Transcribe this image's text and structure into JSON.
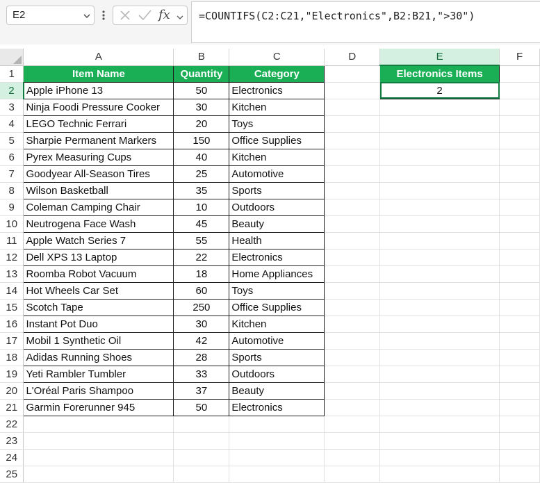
{
  "namebox": {
    "value": "E2"
  },
  "formula_bar": {
    "cancel_icon": "x-icon",
    "enter_icon": "check-icon",
    "function_icon": "fx-icon",
    "formula": "=COUNTIFS(C2:C21,\"Electronics\",B2:B21,\">30\")"
  },
  "grid": {
    "columns": [
      "A",
      "B",
      "C",
      "D",
      "E",
      "F"
    ],
    "active_column": "E",
    "active_row": "2",
    "header_fill": "#1aaf54",
    "row_numbers": [
      "1",
      "2",
      "3",
      "4",
      "5",
      "6",
      "7",
      "8",
      "9",
      "10",
      "11",
      "12",
      "13",
      "14",
      "15",
      "16",
      "17",
      "18",
      "19",
      "20",
      "21",
      "22",
      "23",
      "24",
      "25"
    ],
    "table_headers": [
      "Item Name",
      "Quantity",
      "Category"
    ],
    "rows": [
      [
        "Apple iPhone 13",
        "50",
        "Electronics"
      ],
      [
        "Ninja Foodi Pressure Cooker",
        "30",
        "Kitchen"
      ],
      [
        "LEGO Technic Ferrari",
        "20",
        "Toys"
      ],
      [
        "Sharpie Permanent Markers",
        "150",
        "Office Supplies"
      ],
      [
        "Pyrex Measuring Cups",
        "40",
        "Kitchen"
      ],
      [
        "Goodyear All-Season Tires",
        "25",
        "Automotive"
      ],
      [
        "Wilson Basketball",
        "35",
        "Sports"
      ],
      [
        "Coleman Camping Chair",
        "10",
        "Outdoors"
      ],
      [
        "Neutrogena Face Wash",
        "45",
        "Beauty"
      ],
      [
        "Apple Watch Series 7",
        "55",
        "Health"
      ],
      [
        "Dell XPS 13 Laptop",
        "22",
        "Electronics"
      ],
      [
        "Roomba Robot Vacuum",
        "18",
        "Home Appliances"
      ],
      [
        "Hot Wheels Car Set",
        "60",
        "Toys"
      ],
      [
        "Scotch Tape",
        "250",
        "Office Supplies"
      ],
      [
        "Instant Pot Duo",
        "30",
        "Kitchen"
      ],
      [
        "Mobil 1 Synthetic Oil",
        "42",
        "Automotive"
      ],
      [
        "Adidas Running Shoes",
        "28",
        "Sports"
      ],
      [
        "Yeti Rambler Tumbler",
        "33",
        "Outdoors"
      ],
      [
        "L'Oréal Paris Shampoo",
        "37",
        "Beauty"
      ],
      [
        "Garmin Forerunner 945",
        "50",
        "Electronics"
      ]
    ],
    "result": {
      "header": "Electronics Items",
      "value": "2"
    }
  }
}
